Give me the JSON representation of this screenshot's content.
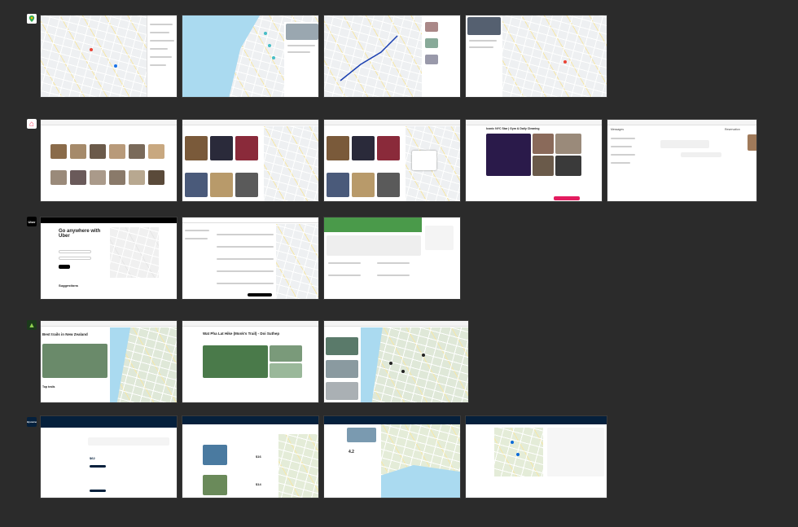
{
  "rows": [
    {
      "app": "Google Maps",
      "icon_label": "",
      "icon_color": "#ffffff"
    },
    {
      "app": "Airbnb",
      "icon_label": "⌂",
      "icon_color": "#ff385c"
    },
    {
      "app": "Uber",
      "icon_label": "Uber",
      "icon_color": "#000000"
    },
    {
      "app": "AllTrails",
      "icon_label": "▲",
      "icon_color": "#1b3a1b"
    },
    {
      "app": "Skyscanner",
      "icon_label": "Skyscanner",
      "icon_color": "#05203c"
    }
  ],
  "uber": {
    "hero_title": "Go anywhere with Uber",
    "suggestions_label": "Suggestions",
    "logo": "Uber"
  },
  "alltrails": {
    "nz_title": "Best trails in New Zealand",
    "top_trails_label": "Top trails",
    "doi_title": "Wat Pha Lat Hike (Monk's Trail) - Doi Suthep",
    "logo": "AllTrails"
  },
  "skyscanner": {
    "logo": "Skyscanner",
    "price_1": "$62",
    "price_2": "$16",
    "price_3": "$14",
    "rating": "4.2"
  },
  "airbnb": {
    "listing_title": "Iconic NYC Star | Gym & Daily Cleaning",
    "messages_label": "Messages",
    "reservation_label": "Reservation"
  }
}
